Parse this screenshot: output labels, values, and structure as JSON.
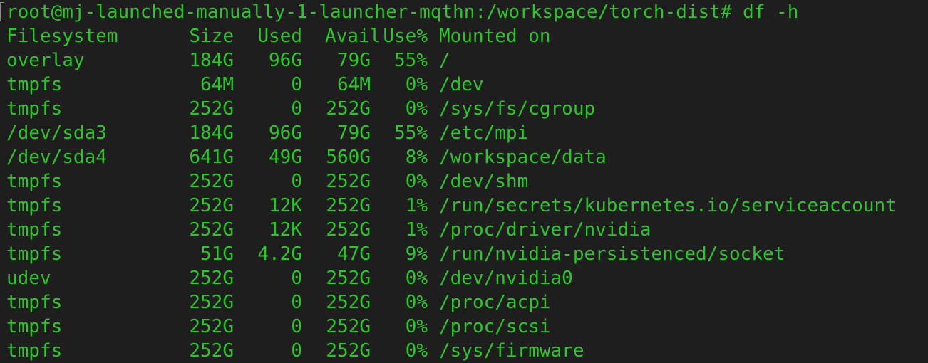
{
  "prompt_line": "root@mj-launched-manually-1-launcher-mqthn:/workspace/torch-dist# df -h",
  "colors": {
    "background": "#1e1e1e",
    "text": "#2fc42d",
    "bracket": "#8a8a8a"
  },
  "header": {
    "filesystem": "Filesystem",
    "size": "Size",
    "used": "Used",
    "avail": "Avail",
    "use_pct": "Use%",
    "mounted_on": "Mounted on"
  },
  "rows": [
    {
      "filesystem": "overlay",
      "size": "184G",
      "used": "96G",
      "avail": "79G",
      "use_pct": "55%",
      "mounted_on": "/"
    },
    {
      "filesystem": "tmpfs",
      "size": "64M",
      "used": "0",
      "avail": "64M",
      "use_pct": "0%",
      "mounted_on": "/dev"
    },
    {
      "filesystem": "tmpfs",
      "size": "252G",
      "used": "0",
      "avail": "252G",
      "use_pct": "0%",
      "mounted_on": "/sys/fs/cgroup"
    },
    {
      "filesystem": "/dev/sda3",
      "size": "184G",
      "used": "96G",
      "avail": "79G",
      "use_pct": "55%",
      "mounted_on": "/etc/mpi"
    },
    {
      "filesystem": "/dev/sda4",
      "size": "641G",
      "used": "49G",
      "avail": "560G",
      "use_pct": "8%",
      "mounted_on": "/workspace/data"
    },
    {
      "filesystem": "tmpfs",
      "size": "252G",
      "used": "0",
      "avail": "252G",
      "use_pct": "0%",
      "mounted_on": "/dev/shm"
    },
    {
      "filesystem": "tmpfs",
      "size": "252G",
      "used": "12K",
      "avail": "252G",
      "use_pct": "1%",
      "mounted_on": "/run/secrets/kubernetes.io/serviceaccount"
    },
    {
      "filesystem": "tmpfs",
      "size": "252G",
      "used": "12K",
      "avail": "252G",
      "use_pct": "1%",
      "mounted_on": "/proc/driver/nvidia"
    },
    {
      "filesystem": "tmpfs",
      "size": "51G",
      "used": "4.2G",
      "avail": "47G",
      "use_pct": "9%",
      "mounted_on": "/run/nvidia-persistenced/socket"
    },
    {
      "filesystem": "udev",
      "size": "252G",
      "used": "0",
      "avail": "252G",
      "use_pct": "0%",
      "mounted_on": "/dev/nvidia0"
    },
    {
      "filesystem": "tmpfs",
      "size": "252G",
      "used": "0",
      "avail": "252G",
      "use_pct": "0%",
      "mounted_on": "/proc/acpi"
    },
    {
      "filesystem": "tmpfs",
      "size": "252G",
      "used": "0",
      "avail": "252G",
      "use_pct": "0%",
      "mounted_on": "/proc/scsi"
    },
    {
      "filesystem": "tmpfs",
      "size": "252G",
      "used": "0",
      "avail": "252G",
      "use_pct": "0%",
      "mounted_on": "/sys/firmware"
    }
  ]
}
